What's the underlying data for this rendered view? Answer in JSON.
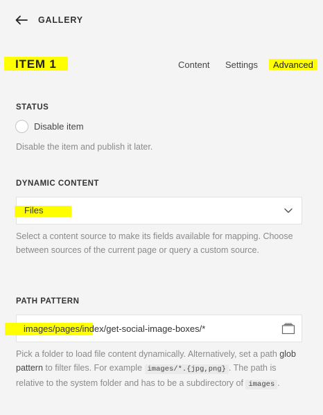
{
  "header": {
    "back_label": "GALLERY"
  },
  "item": {
    "title": "ITEM 1"
  },
  "tabs": [
    {
      "label": "Content"
    },
    {
      "label": "Settings"
    },
    {
      "label": "Advanced"
    }
  ],
  "status": {
    "label": "STATUS",
    "checkbox_label": "Disable item",
    "checked": false,
    "help": "Disable the item and publish it later."
  },
  "dynamic_content": {
    "label": "DYNAMIC CONTENT",
    "selected": "Files",
    "help": "Select a content source to make its fields available for mapping. Choose between sources of the current page or query a custom source."
  },
  "path_pattern": {
    "label": "PATH PATTERN",
    "value": "images/pages/index/get-social-image-boxes/*",
    "help_part1": "Pick a folder to load file content dynamically. Alternatively, set a path ",
    "help_link": "glob pattern",
    "help_part2": " to filter files. For example ",
    "help_code1": "images/*.{jpg,png}",
    "help_part3": ". The path is relative to the system folder and has to be a subdirectory of ",
    "help_code2": "images",
    "help_part4": "."
  },
  "colors": {
    "highlight": "#ffff00",
    "background": "#f4f4f4"
  }
}
